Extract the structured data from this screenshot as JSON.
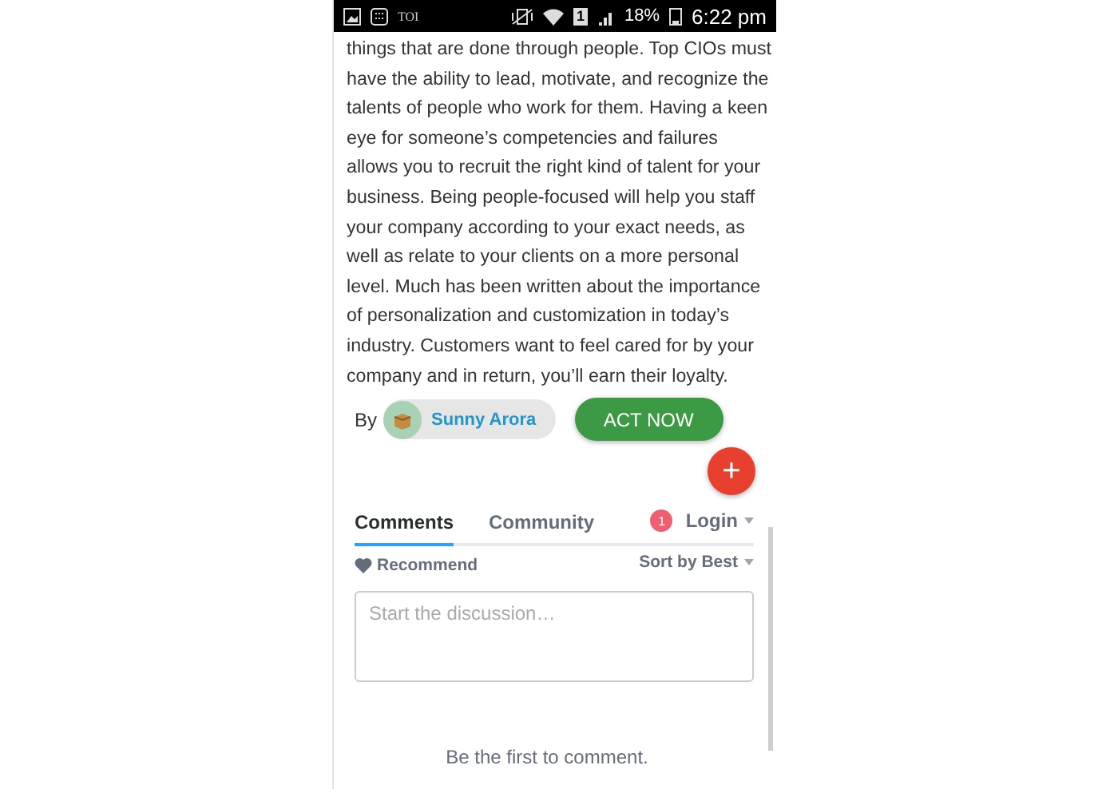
{
  "status_bar": {
    "notification_label": "TOI",
    "sim_slot": "1",
    "battery": "18%",
    "time": "6:22 pm"
  },
  "article": {
    "lines": [
      "things that are done through people. Top CIOs must",
      "have the ability to lead, motivate, and recognize the",
      "talents of people who work for them. Having a keen",
      "eye for someone’s competencies and failures",
      "allows you to recruit the right kind of talent for your",
      "business. Being people-focused will help you staff",
      "your company according to your exact needs, as",
      "well as relate to your clients on a more personal",
      "level. Much has been written about the importance",
      "of personalization and customization in today’s",
      "industry. Customers want to feel cared for by your",
      "company and in return, you’ll earn their loyalty."
    ],
    "by_label": "By",
    "author": "Sunny Arora",
    "action_button": "ACT NOW",
    "fab": "+"
  },
  "comments": {
    "tabs": [
      {
        "label": "Comments",
        "selected": true
      },
      {
        "label": "Community",
        "selected": false
      }
    ],
    "notification_count": "1",
    "login": "Login",
    "recommend": "Recommend",
    "sort": "Sort by Best",
    "input": {
      "placeholder": "Start the discussion…"
    },
    "empty_message": "Be the first to comment."
  }
}
